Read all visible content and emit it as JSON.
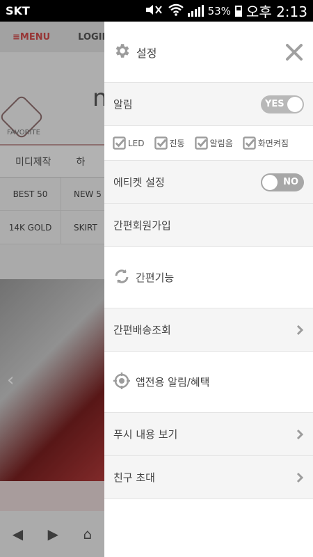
{
  "status_bar": {
    "carrier": "SKT",
    "battery": "53%",
    "time": "오후 2:13"
  },
  "background": {
    "menu": "≡MENU",
    "login": "LOGIN",
    "logo_text": "FAVORITE",
    "big_letter": "n",
    "tabs": [
      "미디제작",
      "하"
    ],
    "grid": [
      [
        "BEST 50",
        "NEW 5"
      ],
      [
        "14K GOLD",
        "SKIRT"
      ]
    ]
  },
  "drawer": {
    "title": "설정",
    "alarm": {
      "label": "알림",
      "toggle": "YES",
      "on": true
    },
    "checkboxes": [
      {
        "label": "LED",
        "checked": true
      },
      {
        "label": "진동",
        "checked": true
      },
      {
        "label": "알림음",
        "checked": true
      },
      {
        "label": "화면켜짐",
        "checked": true
      }
    ],
    "etiquette": {
      "label": "에티켓 설정",
      "toggle": "NO",
      "on": false
    },
    "simple_join": "간편회원가입",
    "simple_feature": "간편기능",
    "delivery": "간편배송조회",
    "app_alarm": "앱전용 알림/혜택",
    "push_view": "푸시 내용 보기",
    "invite": "친구 초대"
  },
  "colors": {
    "accent_gray": "#b8b8b8",
    "icon_gray": "#9c9c9c",
    "menu_red": "#d24c4c"
  }
}
